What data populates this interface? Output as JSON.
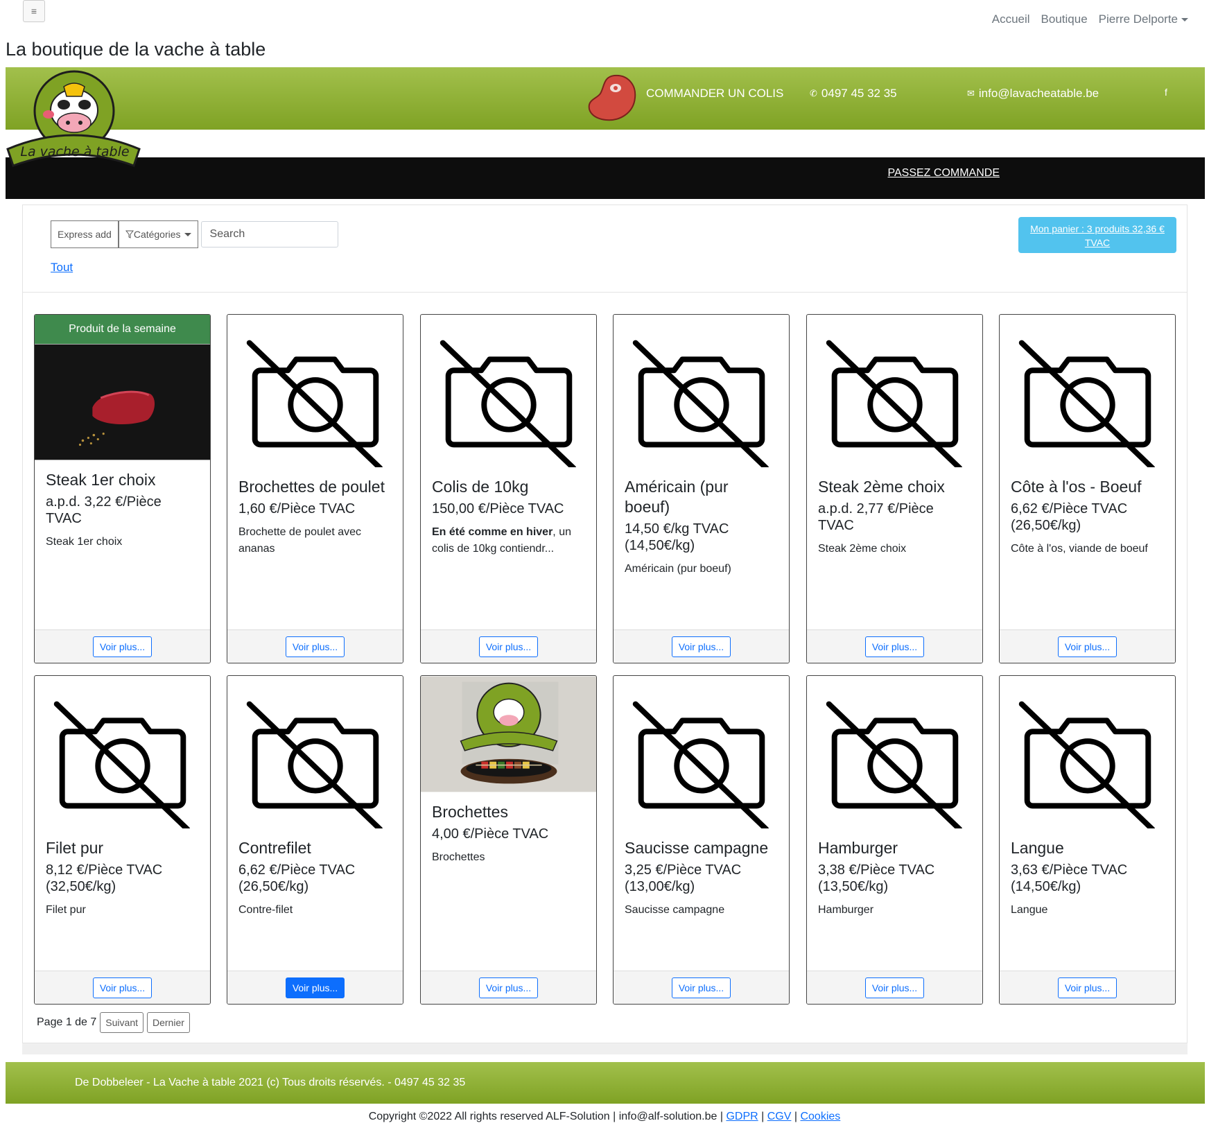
{
  "nav": {
    "menu_icon": "≡",
    "links": [
      "Accueil",
      "Boutique",
      "Pierre Delporte"
    ]
  },
  "site_title": "La boutique de la vache à table",
  "logo_text": "La vache à table",
  "header": {
    "order_label": "COMMANDER UN COLIS",
    "phone": "0497 45 32 35",
    "email": "info@lavacheatable.be",
    "facebook": "f",
    "passez": "PASSEZ COMMANDE"
  },
  "toolbar": {
    "express_add": "Express add",
    "categories": "Catégories",
    "search_placeholder": "Search",
    "tout": "Tout",
    "cart": "Mon panier : 3 produits 32,36 € TVAC"
  },
  "product_of_week": "Produit de la semaine",
  "voir_label": "Voir plus...",
  "products": [
    {
      "name": "Steak 1er choix",
      "price": "a.p.d. 3,22 €/Pièce TVAC",
      "desc": "Steak 1er choix",
      "image": "steak-photo"
    },
    {
      "name": "Brochettes de poulet",
      "price": "1,60 €/Pièce TVAC",
      "desc": "Brochette de poulet avec ananas",
      "image": "no-image"
    },
    {
      "name": "Colis de 10kg",
      "price": "150,00 €/Pièce TVAC",
      "desc_bold": "En été comme en hiver",
      "desc": ", un colis de 10kg contiendr...",
      "image": "no-image"
    },
    {
      "name": "Américain (pur boeuf)",
      "price": "14,50 €/kg TVAC (14,50€/kg)",
      "desc": "Américain (pur boeuf)",
      "image": "no-image"
    },
    {
      "name": "Steak 2ème choix",
      "price": "a.p.d. 2,77 €/Pièce TVAC",
      "desc": "Steak 2ème choix",
      "image": "no-image"
    },
    {
      "name": "Côte à l'os - Boeuf",
      "price": "6,62 €/Pièce TVAC (26,50€/kg)",
      "desc": "Côte à l'os, viande de boeuf",
      "image": "no-image"
    },
    {
      "name": "Filet pur",
      "price": "8,12 €/Pièce TVAC (32,50€/kg)",
      "desc": "Filet pur",
      "image": "no-image"
    },
    {
      "name": "Contrefilet",
      "price": "6,62 €/Pièce TVAC (26,50€/kg)",
      "desc": "Contre-filet",
      "image": "no-image"
    },
    {
      "name": "Brochettes",
      "price": "4,00 €/Pièce TVAC",
      "desc": "Brochettes",
      "image": "brochettes-photo"
    },
    {
      "name": "Saucisse campagne",
      "price": "3,25 €/Pièce TVAC (13,00€/kg)",
      "desc": "Saucisse campagne",
      "image": "no-image"
    },
    {
      "name": "Hamburger",
      "price": "3,38 €/Pièce TVAC (13,50€/kg)",
      "desc": "Hamburger",
      "image": "no-image"
    },
    {
      "name": "Langue",
      "price": "3,63 €/Pièce TVAC (14,50€/kg)",
      "desc": "Langue",
      "image": "no-image"
    }
  ],
  "pager": {
    "label": "Page 1 de 7",
    "next": "Suivant",
    "last": "Dernier"
  },
  "footer": {
    "band": "De Dobbeleer - La Vache à table 2021 (c) Tous droits réservés. - 0497 45 32 35",
    "copyright": "Copyright ©2022 All rights reserved ALF-Solution | info@alf-solution.be |",
    "sep": "|",
    "gdpr": "GDPR",
    "cgv": "CGV",
    "cookies": "Cookies"
  },
  "colors": {
    "green": "#7fa224",
    "week_green": "#3f8a4d",
    "primary": "#0d6efd",
    "cart": "#52c3ee"
  }
}
